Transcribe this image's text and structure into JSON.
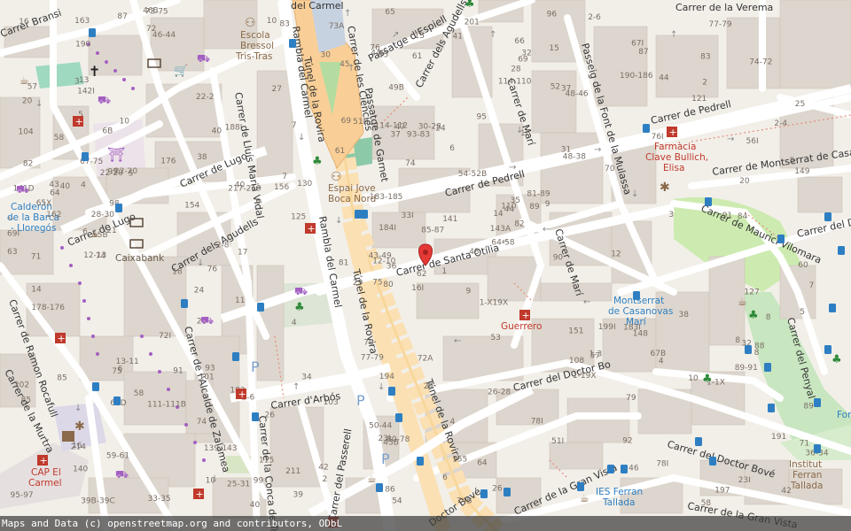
{
  "map": {
    "streets": {
      "carmel_top": "del Carmel",
      "verema": "Carrer de la Verema",
      "bransi": "Carrer Bransi",
      "espiell": "Passatge d'Espiell",
      "agudells_top": "Carrer dels Agudells",
      "ciencies": "Carrer de les Ciències",
      "garnet": "Passatge de Garnet",
      "rambla_carmel_1": "Rambla del Carmel",
      "rambla_carmel_2": "Rambla del Carmel",
      "tunel_rovira_1": "Túnel de la Rovira",
      "tunel_rovira_2": "Túnel de la Rovira",
      "tunel_rovira_3": "Túnel de la Rovira",
      "mari_1": "Carrer de Marí",
      "mari_2": "Carrer de Marí",
      "font_mulassa": "Passeig de la Font de la Mulassa",
      "pedrell_1": "Carrer de Pedrell",
      "pedrell_2": "Carrer de Pedrell",
      "montserrat_casa": "Carrer de Montserrat de Casa",
      "lluis_maria_vidal": "Carrer de Lluís Marià Vidal",
      "lugo_1": "Carrer de Lugo",
      "lugo_2": "Carrer de Lugo",
      "agudells_mid": "Carrer dels Agudells",
      "santa_otilia": "Carrer de Santa Otília",
      "maurici_vilomara": "Carrer de Maurici Vilomara",
      "carrer_del": "Carrer del D",
      "ramon_rocafull": "Carrer de Ramon Rocafull",
      "alcalde_zalamea": "Carrer de l'Alcalde de Zalamea",
      "murtra": "Carrer de la Murtra",
      "arbos": "Carrer d'Arbós",
      "passerell": "Carrer del Passerell",
      "conca_tremp": "Carrer de la Conca de Tr",
      "doctor_bove_1": "Carrer del Doctor Bo",
      "doctor_bove_2": "Carrer del Doctor Bové",
      "doctor_bove_3": "Doctor Bové",
      "gran_vista_1": "Carrer de la Gran Vista",
      "gran_vista_2": "Carrer de la Gran Vista",
      "penyal": "Carrer del Penyal"
    },
    "pois": {
      "escola": "Escola",
      "bressol": "Bressol",
      "tris_tras": "Tris-Tras",
      "espai_jove_1": "Espai Jove",
      "espai_jove_2": "Boca Nord",
      "farmacia_1": "Farmàcia",
      "farmacia_2": "Clave Bullich,",
      "farmacia_3": "Elisa",
      "calderon_1": "Calderón",
      "calderon_2": "de la Barca",
      "calderon_3": "- Lloregós",
      "caixabank": "Caixabank",
      "montserrat_1": "Montserrat",
      "montserrat_2": "de Casanovas",
      "montserrat_3": "Marí",
      "guerrero": "Guerrero",
      "cap_1": "CAP El",
      "cap_2": "Carmel",
      "institut_1": "Institut",
      "institut_2": "Ferran",
      "institut_3": "Tallada",
      "ies_1": "IES Ferran",
      "ies_2": "Tallada",
      "font": "Font"
    },
    "house_numbers": [
      "16I",
      "6B",
      "12-10",
      "16",
      "14",
      "2-6",
      "15",
      "30-28",
      "37",
      "48",
      "46-44",
      "42",
      "21",
      "25",
      "29",
      "31",
      "33-35",
      "114-112",
      "54-52B",
      "58",
      "130",
      "140",
      "139-143",
      "47",
      "44",
      "148",
      "10",
      "15",
      "162",
      "151",
      "149",
      "43-49",
      "50-44",
      "184I",
      "188I",
      "190-186",
      "183",
      "197",
      "191",
      "183I",
      "201",
      "156",
      "154",
      "1-19X",
      "25-31",
      "141D",
      "143A",
      "39B-39C",
      "43B",
      "64-58",
      "63D",
      "56I",
      "57",
      "57",
      "51I",
      "74",
      "72",
      "163",
      "4",
      "2",
      "15",
      "17",
      "40",
      "38",
      "44",
      "46B",
      "32",
      "45",
      "33I",
      "202",
      "194",
      "211",
      "199I",
      "217-219",
      "214",
      "190",
      "176",
      "178-176",
      "183-185",
      "155",
      "141",
      "59-61",
      "90",
      "88",
      "86",
      "84",
      "72A",
      "78I",
      "74B",
      "78I",
      "76",
      "7",
      "9",
      "79",
      "85-87",
      "89-91",
      "64",
      "54",
      "52",
      "48-46",
      "18",
      "10",
      "60",
      "65X",
      "72I",
      "101",
      "115",
      "110",
      "121",
      "125",
      "127",
      "142I",
      "93-83",
      "81",
      "83",
      "85",
      "80",
      "74-72",
      "69",
      "73A",
      "75",
      "77-79",
      "6",
      "7",
      "12",
      "20",
      "23I",
      "2",
      "3",
      "5",
      "6",
      "26",
      "40",
      "27",
      "8",
      "4",
      "11",
      "13-11",
      "5",
      "7",
      "9",
      "98",
      "10",
      "1",
      "35",
      "13",
      "42",
      "46",
      "23I",
      "44I",
      "20",
      "40",
      "43",
      "39",
      "38",
      "41",
      "49B",
      "74",
      "76",
      "95",
      "53",
      "61",
      "63",
      "65",
      "69",
      "67-75",
      "70",
      "71",
      "73-75",
      "58",
      "1-1X",
      "64",
      "82",
      "66",
      "81-89",
      "99",
      "114-110",
      "108",
      "104",
      "99",
      "58",
      "62",
      "6",
      "4",
      "3",
      "5",
      "22-20",
      "28-30",
      "26",
      "36",
      "32",
      "34",
      "37",
      "76I",
      "82",
      "80-78",
      "74",
      "51B",
      "67B",
      "91",
      "55B",
      "67I",
      "61",
      "69I",
      "70",
      "71",
      "75",
      "85",
      "77-79",
      "87",
      "89",
      "2-4",
      "6",
      "8",
      "91",
      "103",
      "111-111B",
      "1-X19X",
      "4",
      "6",
      "30",
      "24",
      "95-97",
      "18",
      "10",
      "93",
      "89",
      "83",
      "87",
      "92",
      "96",
      "20",
      "40",
      "16",
      "24",
      "28",
      "2-8",
      "12-13",
      "14",
      "1-3",
      "5",
      "8",
      "2-6",
      "22-20",
      "24",
      "26-28",
      "36-34",
      "22-2",
      "48-38"
    ],
    "attribution": "Maps and Data (c) openstreetmap.org and contributors, ODbL"
  }
}
